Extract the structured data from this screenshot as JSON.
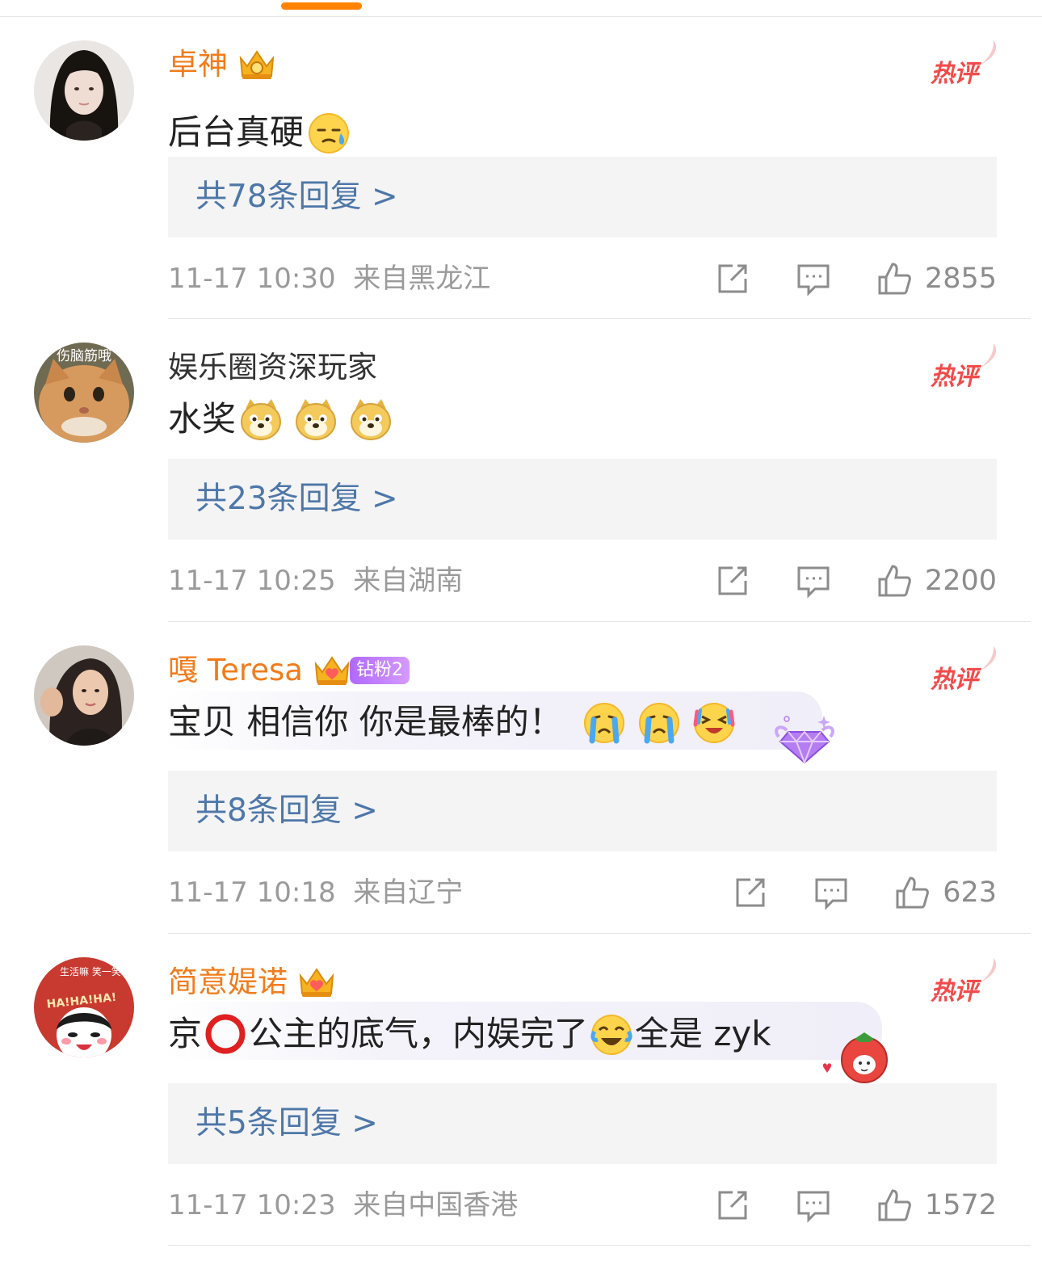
{
  "accent_color": "#ff8200",
  "hot_label": "热评",
  "comments": [
    {
      "username": "卓神",
      "name_color": "#f07c1c",
      "badges": [
        "crown-badge-icon"
      ],
      "text": "后台真硬",
      "emojis_after": [
        "sweat-emoji"
      ],
      "replies": "共78条回复 >",
      "time": "11-17 10:30",
      "location": "来自黑龙江",
      "likes": "2855"
    },
    {
      "username": "娱乐圈资深玩家",
      "name_color": "#333333",
      "badges": [],
      "avatar_caption": "伤脑筋哦",
      "text": "水奖",
      "emojis_after": [
        "doge-emoji",
        "doge-emoji",
        "doge-emoji"
      ],
      "replies": "共23条回复 >",
      "time": "11-17 10:25",
      "location": "来自湖南",
      "likes": "2200"
    },
    {
      "username": "嘎 Teresa",
      "name_color": "#f07c1c",
      "badges": [
        "crown-badge-icon"
      ],
      "fan_badge": "钻粉2",
      "text": "宝贝 相信你 你是最棒的！",
      "emojis_after": [
        "crying-emoji",
        "crying-emoji",
        "laugh-cry-emoji"
      ],
      "bubble_decoration": "gem-icon",
      "replies": "共8条回复 >",
      "time": "11-17 10:18",
      "location": "来自辽宁",
      "likes": "623"
    },
    {
      "username": "简意媞诺",
      "name_color": "#f07c1c",
      "badges": [
        "crown-badge-icon"
      ],
      "avatar_caption": "生活嘛 笑一笑就好了",
      "avatar_shout": "HA!HA!HA!",
      "text_before": "京",
      "text_middle": "公主的底气，内娱完了",
      "text_after": "全是 zyk",
      "emojis_inline": [
        "red-circle-emoji",
        "laugh-cry-emoji"
      ],
      "bubble_decoration": "strawberry-icon",
      "replies": "共5条回复 >",
      "time": "11-17 10:23",
      "location": "来自中国香港",
      "likes": "1572"
    }
  ]
}
